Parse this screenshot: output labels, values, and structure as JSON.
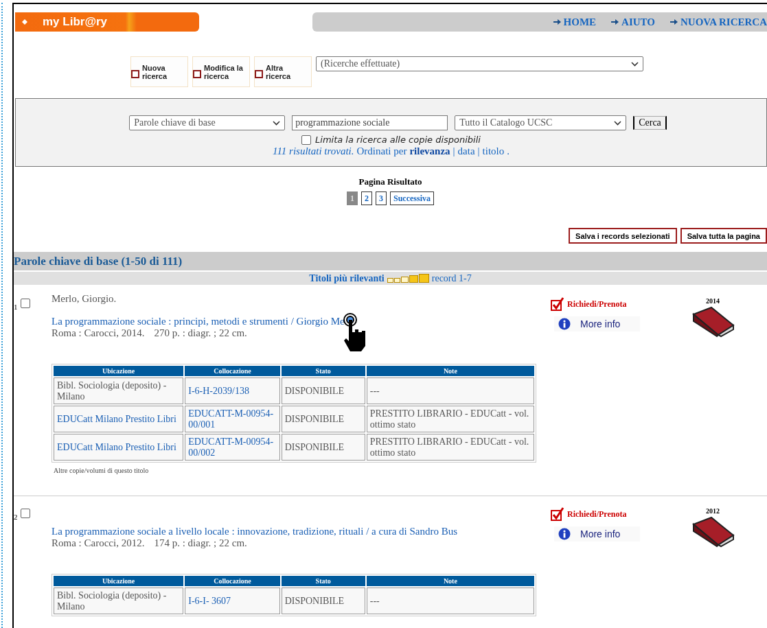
{
  "header": {
    "logo": "my Libr@ry",
    "nav": [
      "HOME",
      "AIUTO",
      "NUOVA RICERCA"
    ]
  },
  "tools": [
    "Nuova ricerca",
    "Modifica la ricerca",
    "Altra ricerca"
  ],
  "history_select": "(Ricerche effettuate)",
  "search": {
    "field_select": "Parole chiave di base",
    "query": "programmazione sociale",
    "catalog_select": "Tutto il Catalogo UCSC",
    "button": "Cerca",
    "limit": {
      "label": "Limita la ricerca alle copie disponibili",
      "checked": false
    },
    "results": {
      "count": "111 risultati trovati.",
      "sorted_by": "Ordinati per",
      "separator": "|",
      "end": ".",
      "sort_options": [
        {
          "label": "rilevanza",
          "selected": true
        },
        {
          "label": "data",
          "selected": false
        },
        {
          "label": "titolo",
          "selected": false
        }
      ]
    }
  },
  "pagination": {
    "title": "Pagina Risultato",
    "pages": [
      {
        "label": "1",
        "selected": true
      },
      {
        "label": "2",
        "selected": false
      },
      {
        "label": "3",
        "selected": false
      }
    ],
    "next": "Successiva"
  },
  "save_buttons": [
    "Salva i records selezionati",
    "Salva tutta la pagina"
  ],
  "section": {
    "title": "Parole chiave di base (1-50 di 111)",
    "relevance_label": "Titoli più rilevanti",
    "relevance": {
      "stars": 2
    },
    "record_range": "record 1-7"
  },
  "records": [
    {
      "number": "1",
      "checked": false,
      "author": "Merlo, Giorgio.",
      "title": "La programmazione sociale : principi, metodi e strumenti / Giorgio Me",
      "cursor": true,
      "publisher": "Roma : Carocci, 2014.",
      "extent": "270 p. : diagr. ; 22 cm.",
      "request": "Richiedi/Prenota",
      "more_info": "More info",
      "year": "2014",
      "columns": [
        "Ubicazione",
        "Collocazione",
        "Stato",
        "Note"
      ],
      "holdings": [
        {
          "location": "Bibl. Sociologia (deposito) - Milano",
          "linked": false,
          "call_number": "I-6-H-2039/138",
          "status": "DISPONIBILE",
          "note": "---"
        },
        {
          "location": "EDUCatt Milano Prestito Libri",
          "linked": true,
          "call_number": "EDUCATT-M-00954-00/001",
          "status": "DISPONIBILE",
          "note": "PRESTITO LIBRARIO -  EDUCatt - vol. ottimo stato"
        },
        {
          "location": "EDUCatt Milano Prestito Libri",
          "linked": true,
          "call_number": "EDUCATT-M-00954-00/002",
          "status": "DISPONIBILE",
          "note": "PRESTITO LIBRARIO -  EDUCatt - vol. ottimo stato"
        }
      ],
      "more_copies": "Altre copie/volumi di questo titolo"
    },
    {
      "number": "2",
      "checked": false,
      "title": "La programmazione sociale a livello locale : innovazione, tradizione, rituali / a cura di Sandro Bus",
      "cursor": false,
      "publisher": "Roma : Carocci, 2012.",
      "extent": "174 p. : diagr. ; 22 cm.",
      "request": "Richiedi/Prenota",
      "more_info": "More info",
      "year": "2012",
      "columns": [
        "Ubicazione",
        "Collocazione",
        "Stato",
        "Note"
      ],
      "holdings": [
        {
          "location": "Bibl. Sociologia (deposito) - Milano",
          "linked": false,
          "call_number": "I-6-I- 3607",
          "status": "DISPONIBILE",
          "note": "---"
        }
      ]
    }
  ]
}
